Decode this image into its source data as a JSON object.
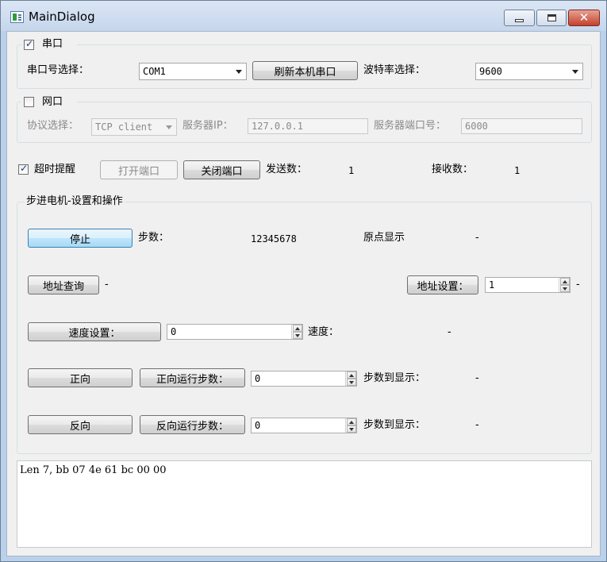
{
  "window": {
    "title": "MainDialog"
  },
  "serial": {
    "group_label": "串口",
    "enabled": true,
    "port_label": "串口号选择：",
    "port_value": "COM1",
    "refresh_label": "刷新本机串口",
    "baud_label": "波特率选择：",
    "baud_value": "9600"
  },
  "network": {
    "group_label": "网口",
    "enabled": false,
    "protocol_label": "协议选择：",
    "protocol_value": "TCP client",
    "server_ip_label": "服务器IP：",
    "server_ip_value": "127.0.0.1",
    "server_port_label": "服务器端口号：",
    "server_port_value": "6000"
  },
  "conn": {
    "timeout_label": "超时提醒",
    "timeout_checked": true,
    "open_label": "打开端口",
    "close_label": "关闭端口",
    "sent_label": "发送数：",
    "sent_value": "1",
    "recv_label": "接收数：",
    "recv_value": "1"
  },
  "motor": {
    "group_label": "步进电机-设置和操作",
    "stop_label": "停止",
    "steps_label": "步数：",
    "steps_value": "12345678",
    "origin_label": "原点显示",
    "origin_value": "-",
    "addr_query_label": "地址查询",
    "addr_query_value": "-",
    "addr_set_label": "地址设置：",
    "addr_set_value": "1",
    "addr_set_suffix": "-",
    "speed_set_label": "速度设置：",
    "speed_set_value": "0",
    "speed_label": "速度：",
    "speed_value": "-",
    "forward_label": "正向",
    "forward_steps_label": "正向运行步数：",
    "forward_steps_value": "0",
    "forward_reached_label": "步数到显示：",
    "forward_reached_value": "-",
    "reverse_label": "反向",
    "reverse_steps_label": "反向运行步数：",
    "reverse_steps_value": "0",
    "reverse_reached_label": "步数到显示：",
    "reverse_reached_value": "-"
  },
  "log": {
    "text": "Len 7, bb 07 4e 61 bc 00 00"
  }
}
